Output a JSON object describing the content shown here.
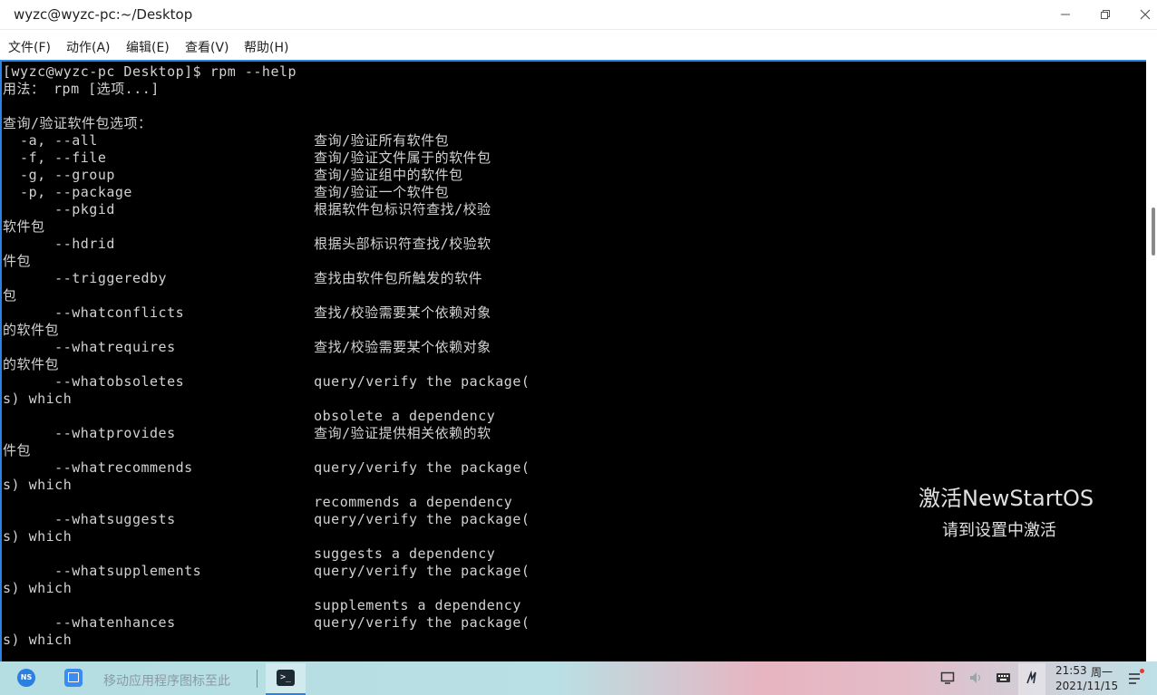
{
  "window": {
    "title": "wyzc@wyzc-pc:~/Desktop",
    "controls": [
      "minimize-icon",
      "restore-icon",
      "close-icon"
    ]
  },
  "menu": {
    "items": [
      "文件(F)",
      "动作(A)",
      "编辑(E)",
      "查看(V)",
      "帮助(H)"
    ]
  },
  "terminal": {
    "lines": [
      "[wyzc@wyzc-pc Desktop]$ rpm --help",
      "用法： rpm [选项...]",
      "",
      "查询/验证软件包选项：",
      "  -a, --all                         查询/验证所有软件包",
      "  -f, --file                        查询/验证文件属于的软件包",
      "  -g, --group                       查询/验证组中的软件包",
      "  -p, --package                     查询/验证一个软件包",
      "      --pkgid                       根据软件包标识符查找/校验",
      "软件包",
      "      --hdrid                       根据头部标识符查找/校验软",
      "件包",
      "      --triggeredby                 查找由软件包所触发的软件",
      "包",
      "      --whatconflicts               查找/校验需要某个依赖对象",
      "的软件包",
      "      --whatrequires                查找/校验需要某个依赖对象",
      "的软件包",
      "      --whatobsoletes               query/verify the package(",
      "s) which",
      "                                    obsolete a dependency",
      "      --whatprovides                查询/验证提供相关依赖的软",
      "件包",
      "      --whatrecommends              query/verify the package(",
      "s) which",
      "                                    recommends a dependency",
      "      --whatsuggests                query/verify the package(",
      "s) which",
      "                                    suggests a dependency",
      "      --whatsupplements             query/verify the package(",
      "s) which",
      "                                    supplements a dependency",
      "      --whatenhances                query/verify the package(",
      "s) which"
    ]
  },
  "watermark": {
    "title": "激活NewStartOS",
    "subtitle": "请到设置中激活"
  },
  "taskbar": {
    "start_label": "NS",
    "pin_hint": "移动应用程序图标至此",
    "terminal_glyph": ">_",
    "tray_icons": [
      "monitor-icon",
      "volume-icon",
      "keyboard-icon",
      "input-method-icon"
    ],
    "clock": {
      "time": "21:53",
      "weekday": "周一",
      "date": "2021/11/15"
    }
  },
  "colors": {
    "accent": "#2a82e4",
    "terminal_bg": "#000000",
    "terminal_fg": "#d2d2d2"
  }
}
